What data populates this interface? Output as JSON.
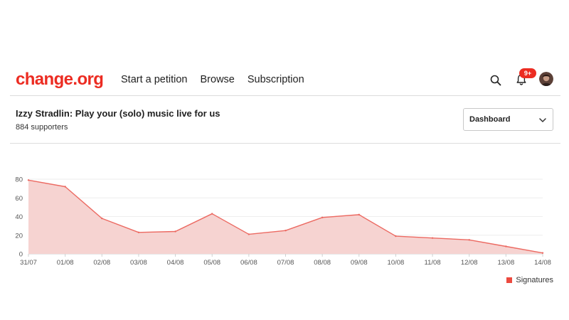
{
  "header": {
    "logo": "change.org",
    "nav": [
      "Start a petition",
      "Browse",
      "Subscription"
    ],
    "notification_badge": "9+",
    "icons": [
      "search-icon",
      "bell-icon",
      "avatar"
    ]
  },
  "petition": {
    "title": "Izzy Stradlin: Play your (solo) music live for us",
    "supporters": "884 supporters",
    "view_select": "Dashboard"
  },
  "colors": {
    "brand": "#ec2c22",
    "area_fill": "#f6d3d1",
    "line": "#ec6a62",
    "grid": "#eeeeee"
  },
  "chart_data": {
    "type": "area",
    "x": [
      "31/07",
      "01/08",
      "02/08",
      "03/08",
      "04/08",
      "05/08",
      "06/08",
      "07/08",
      "08/08",
      "09/08",
      "10/08",
      "11/08",
      "12/08",
      "13/08",
      "14/08"
    ],
    "series": [
      {
        "name": "Signatures",
        "values": [
          79,
          72,
          38,
          23,
          24,
          43,
          21,
          25,
          39,
          42,
          19,
          17,
          15,
          8,
          1
        ]
      }
    ],
    "yticks": [
      0,
      20,
      40,
      60,
      80
    ],
    "ylim": [
      0,
      80
    ],
    "grid": true,
    "legend": "bottom-right"
  }
}
